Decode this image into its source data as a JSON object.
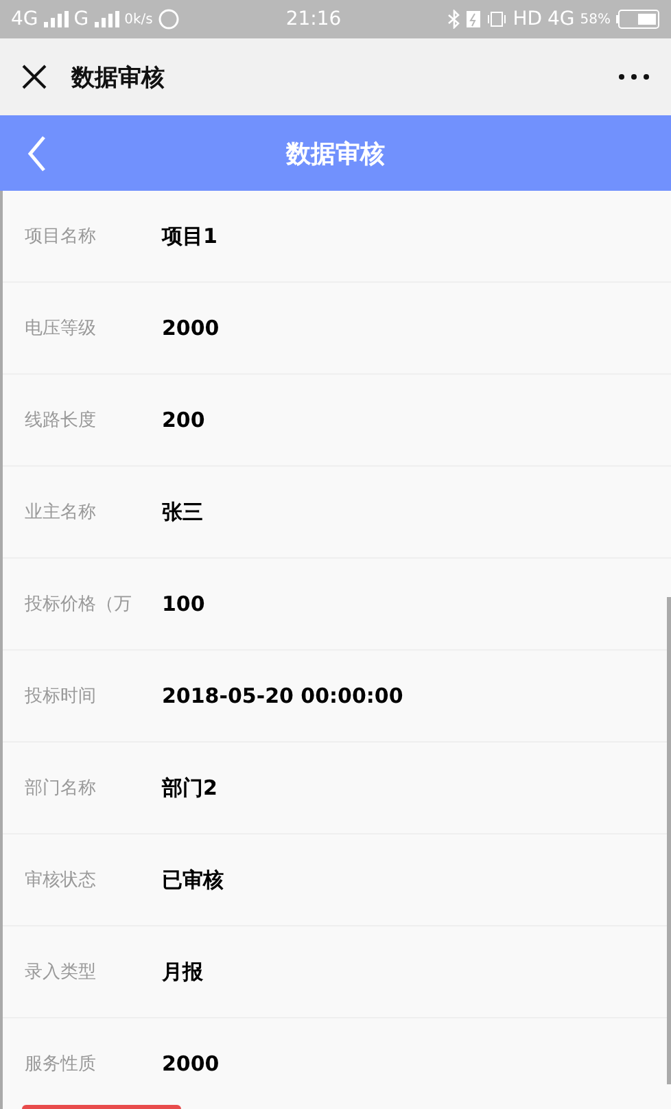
{
  "status_bar": {
    "network_1": "4G",
    "network_2": "G",
    "speed": "0k/s",
    "time": "21:16",
    "hd": "HD",
    "network_3": "4G",
    "battery": "58%"
  },
  "app_bar": {
    "title": "数据审核"
  },
  "header": {
    "title": "数据审核"
  },
  "fields": [
    {
      "label": "项目名称",
      "value": "项目1"
    },
    {
      "label": "电压等级",
      "value": "2000"
    },
    {
      "label": "线路长度",
      "value": "200"
    },
    {
      "label": "业主名称",
      "value": "张三"
    },
    {
      "label": "投标价格（万",
      "value": "100"
    },
    {
      "label": "投标时间",
      "value": "2018-05-20 00:00:00"
    },
    {
      "label": "部门名称",
      "value": "部门2"
    },
    {
      "label": "审核状态",
      "value": "已审核"
    },
    {
      "label": "录入类型",
      "value": "月报"
    },
    {
      "label": "服务性质",
      "value": "2000"
    }
  ]
}
